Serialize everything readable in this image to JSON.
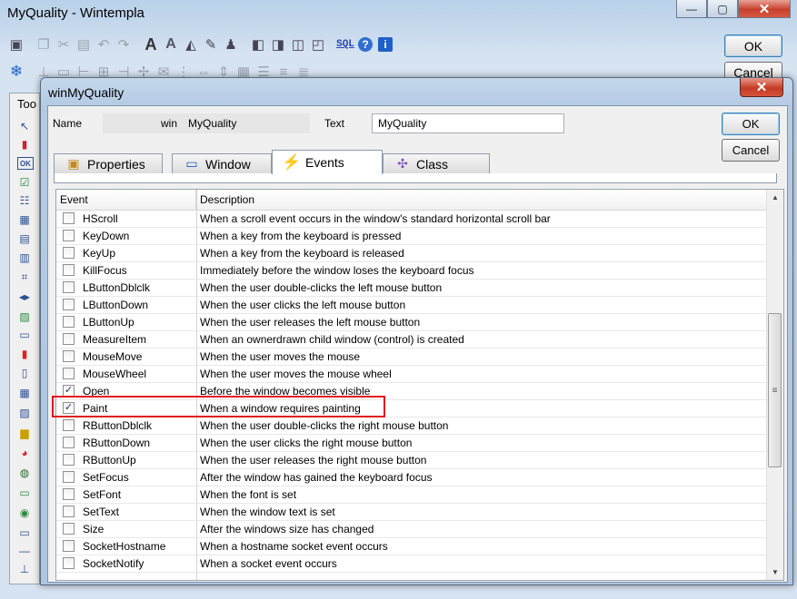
{
  "outer": {
    "title": "MyQuality   -   Wintempla",
    "minimize_glyph": "—",
    "maximize_glyph": "▢",
    "close_glyph": "✕",
    "ok_label": "OK",
    "cancel_label": "Cancel",
    "toolbox_label": "Too",
    "sql_label": "SQL"
  },
  "dialog": {
    "title": "winMyQuality",
    "close_glyph": "✕",
    "name_label": "Name",
    "name_prefix": "win",
    "name_value": "MyQuality",
    "text_label": "Text",
    "text_value": "MyQuality",
    "ok_label": "OK",
    "cancel_label": "Cancel",
    "tabs": [
      {
        "label": "Properties",
        "icon": "properties-icon"
      },
      {
        "label": "Window",
        "icon": "window-icon"
      },
      {
        "label": "Events",
        "icon": "lightning-icon",
        "active": true
      },
      {
        "label": "Class",
        "icon": "class-icon"
      }
    ]
  },
  "grid": {
    "columns": [
      "Event",
      "Description"
    ],
    "rows": [
      {
        "event": "HScroll",
        "description": "When a scroll event occurs in the window's standard horizontal scroll bar",
        "checked": false
      },
      {
        "event": "KeyDown",
        "description": "When a key from the keyboard is pressed",
        "checked": false
      },
      {
        "event": "KeyUp",
        "description": "When a key from the keyboard is released",
        "checked": false
      },
      {
        "event": "KillFocus",
        "description": "Immediately before the window loses the keyboard focus",
        "checked": false
      },
      {
        "event": "LButtonDblclk",
        "description": "When the user double-clicks the left mouse button",
        "checked": false
      },
      {
        "event": "LButtonDown",
        "description": "When the user clicks the left mouse button",
        "checked": false
      },
      {
        "event": "LButtonUp",
        "description": "When the user releases the left mouse button",
        "checked": false
      },
      {
        "event": "MeasureItem",
        "description": "When an ownerdrawn child window (control) is created",
        "checked": false
      },
      {
        "event": "MouseMove",
        "description": "When the user moves the mouse",
        "checked": false
      },
      {
        "event": "MouseWheel",
        "description": "When the user moves the mouse wheel",
        "checked": false
      },
      {
        "event": "Open",
        "description": "Before the window becomes visible",
        "checked": true
      },
      {
        "event": "Paint",
        "description": "When a window requires painting",
        "checked": true,
        "highlighted": true
      },
      {
        "event": "RButtonDblclk",
        "description": "When the user double-clicks the right mouse button",
        "checked": false
      },
      {
        "event": "RButtonDown",
        "description": "When the user clicks the right mouse button",
        "checked": false
      },
      {
        "event": "RButtonUp",
        "description": "When the user releases the right mouse button",
        "checked": false
      },
      {
        "event": "SetFocus",
        "description": "After the window has gained the keyboard focus",
        "checked": false
      },
      {
        "event": "SetFont",
        "description": "When the font is set",
        "checked": false
      },
      {
        "event": "SetText",
        "description": "When the window text is set",
        "checked": false
      },
      {
        "event": "Size",
        "description": "After the windows size has changed",
        "checked": false
      },
      {
        "event": "SocketHostname",
        "description": "When a hostname socket event occurs",
        "checked": false
      },
      {
        "event": "SocketNotify",
        "description": "When a socket event occurs",
        "checked": false
      }
    ],
    "check_glyph": "✓"
  },
  "colors": {
    "highlight": "#e0191c",
    "title_bar": "#b9d1ea",
    "ok_focus": "#3c7fb1"
  }
}
